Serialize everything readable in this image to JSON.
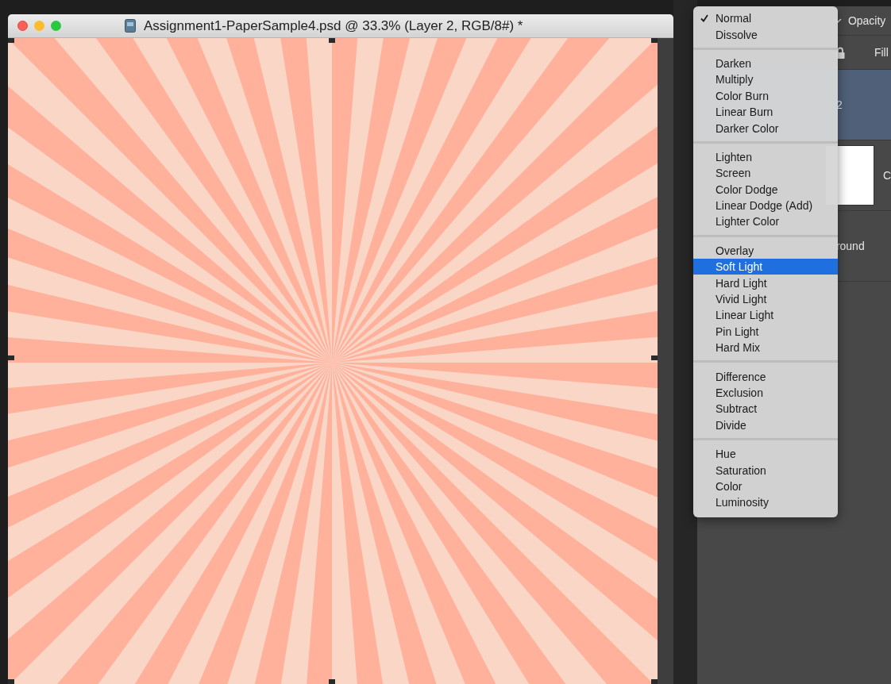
{
  "window": {
    "title": "Assignment1-PaperSample4.psd @ 33.3% (Layer 2, RGB/8#) *"
  },
  "layers_panel": {
    "opacity_label": "Opacity",
    "fill_label": "Fill",
    "layers": [
      {
        "name": "2",
        "selected": true,
        "thumbnail": false
      },
      {
        "name": "C",
        "selected": false,
        "thumbnail": true
      },
      {
        "name": "round",
        "selected": false,
        "thumbnail": false
      }
    ]
  },
  "blend_menu": {
    "groups": [
      [
        {
          "label": "Normal",
          "checked": true,
          "selected": false
        },
        {
          "label": "Dissolve",
          "checked": false,
          "selected": false
        }
      ],
      [
        {
          "label": "Darken",
          "checked": false,
          "selected": false
        },
        {
          "label": "Multiply",
          "checked": false,
          "selected": false
        },
        {
          "label": "Color Burn",
          "checked": false,
          "selected": false
        },
        {
          "label": "Linear Burn",
          "checked": false,
          "selected": false
        },
        {
          "label": "Darker Color",
          "checked": false,
          "selected": false
        }
      ],
      [
        {
          "label": "Lighten",
          "checked": false,
          "selected": false
        },
        {
          "label": "Screen",
          "checked": false,
          "selected": false
        },
        {
          "label": "Color Dodge",
          "checked": false,
          "selected": false
        },
        {
          "label": "Linear Dodge (Add)",
          "checked": false,
          "selected": false
        },
        {
          "label": "Lighter Color",
          "checked": false,
          "selected": false
        }
      ],
      [
        {
          "label": "Overlay",
          "checked": false,
          "selected": false
        },
        {
          "label": "Soft Light",
          "checked": false,
          "selected": true
        },
        {
          "label": "Hard Light",
          "checked": false,
          "selected": false
        },
        {
          "label": "Vivid Light",
          "checked": false,
          "selected": false
        },
        {
          "label": "Linear Light",
          "checked": false,
          "selected": false
        },
        {
          "label": "Pin Light",
          "checked": false,
          "selected": false
        },
        {
          "label": "Hard Mix",
          "checked": false,
          "selected": false
        }
      ],
      [
        {
          "label": "Difference",
          "checked": false,
          "selected": false
        },
        {
          "label": "Exclusion",
          "checked": false,
          "selected": false
        },
        {
          "label": "Subtract",
          "checked": false,
          "selected": false
        },
        {
          "label": "Divide",
          "checked": false,
          "selected": false
        }
      ],
      [
        {
          "label": "Hue",
          "checked": false,
          "selected": false
        },
        {
          "label": "Saturation",
          "checked": false,
          "selected": false
        },
        {
          "label": "Color",
          "checked": false,
          "selected": false
        },
        {
          "label": "Luminosity",
          "checked": false,
          "selected": false
        }
      ]
    ]
  }
}
